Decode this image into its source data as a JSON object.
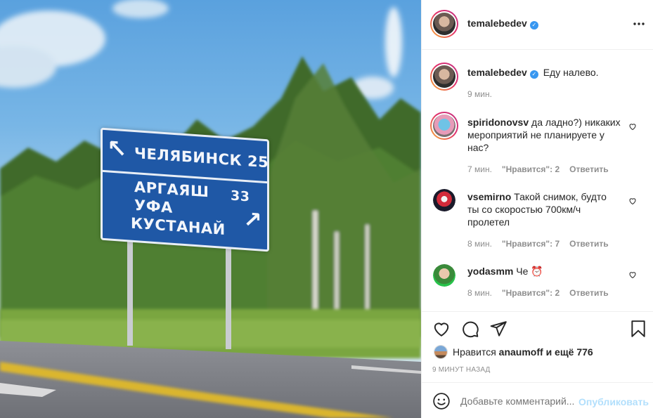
{
  "photo": {
    "sign": {
      "line1": "ЧЕЛЯБИНСК 25",
      "line2": "АРГАЯШ",
      "line2_distance": "33",
      "line3": "УФА",
      "line4": "КУСТАНАЙ"
    }
  },
  "post": {
    "author": "temalebedev",
    "caption": "Еду налево.",
    "caption_time": "9 мин.",
    "more_icon": "more-horizontal-icon",
    "liked_by": "anaumoff",
    "likes_prefix": "Нравится",
    "likes_others": "и ещё 776",
    "timestamp": "9 МИНУТ НАЗАД"
  },
  "comments": [
    {
      "user": "spiridonovsv",
      "line1": "да ладно?) никаких",
      "line2": "мероприятий не планируете у",
      "line3": "нас?",
      "time": "7 мин.",
      "likes": "\"Нравится\": 2",
      "reply": "Ответить"
    },
    {
      "user": "vsemirno",
      "line1": "Такой снимок, будто",
      "line2": "ты со скоростью 700км/ч",
      "line3": "пролетел",
      "time": "8 мин.",
      "likes": "\"Нравится\": 7",
      "reply": "Ответить"
    },
    {
      "user": "yodasmm",
      "line1": "Че ⏰",
      "time": "8 мин.",
      "likes": "\"Нравится\": 2",
      "reply": "Ответить"
    }
  ],
  "actions": {
    "like_icon": "heart-icon",
    "comment_icon": "comment-icon",
    "share_icon": "paper-plane-icon",
    "save_icon": "bookmark-icon"
  },
  "composer": {
    "placeholder": "Добавьте комментарий...",
    "post_label": "Опубликовать",
    "emoji_icon": "smile-icon"
  },
  "colors": {
    "verified": "#3897f0",
    "post_link_disabled": "#b2dffc",
    "meta_text": "#8e8e8e"
  }
}
